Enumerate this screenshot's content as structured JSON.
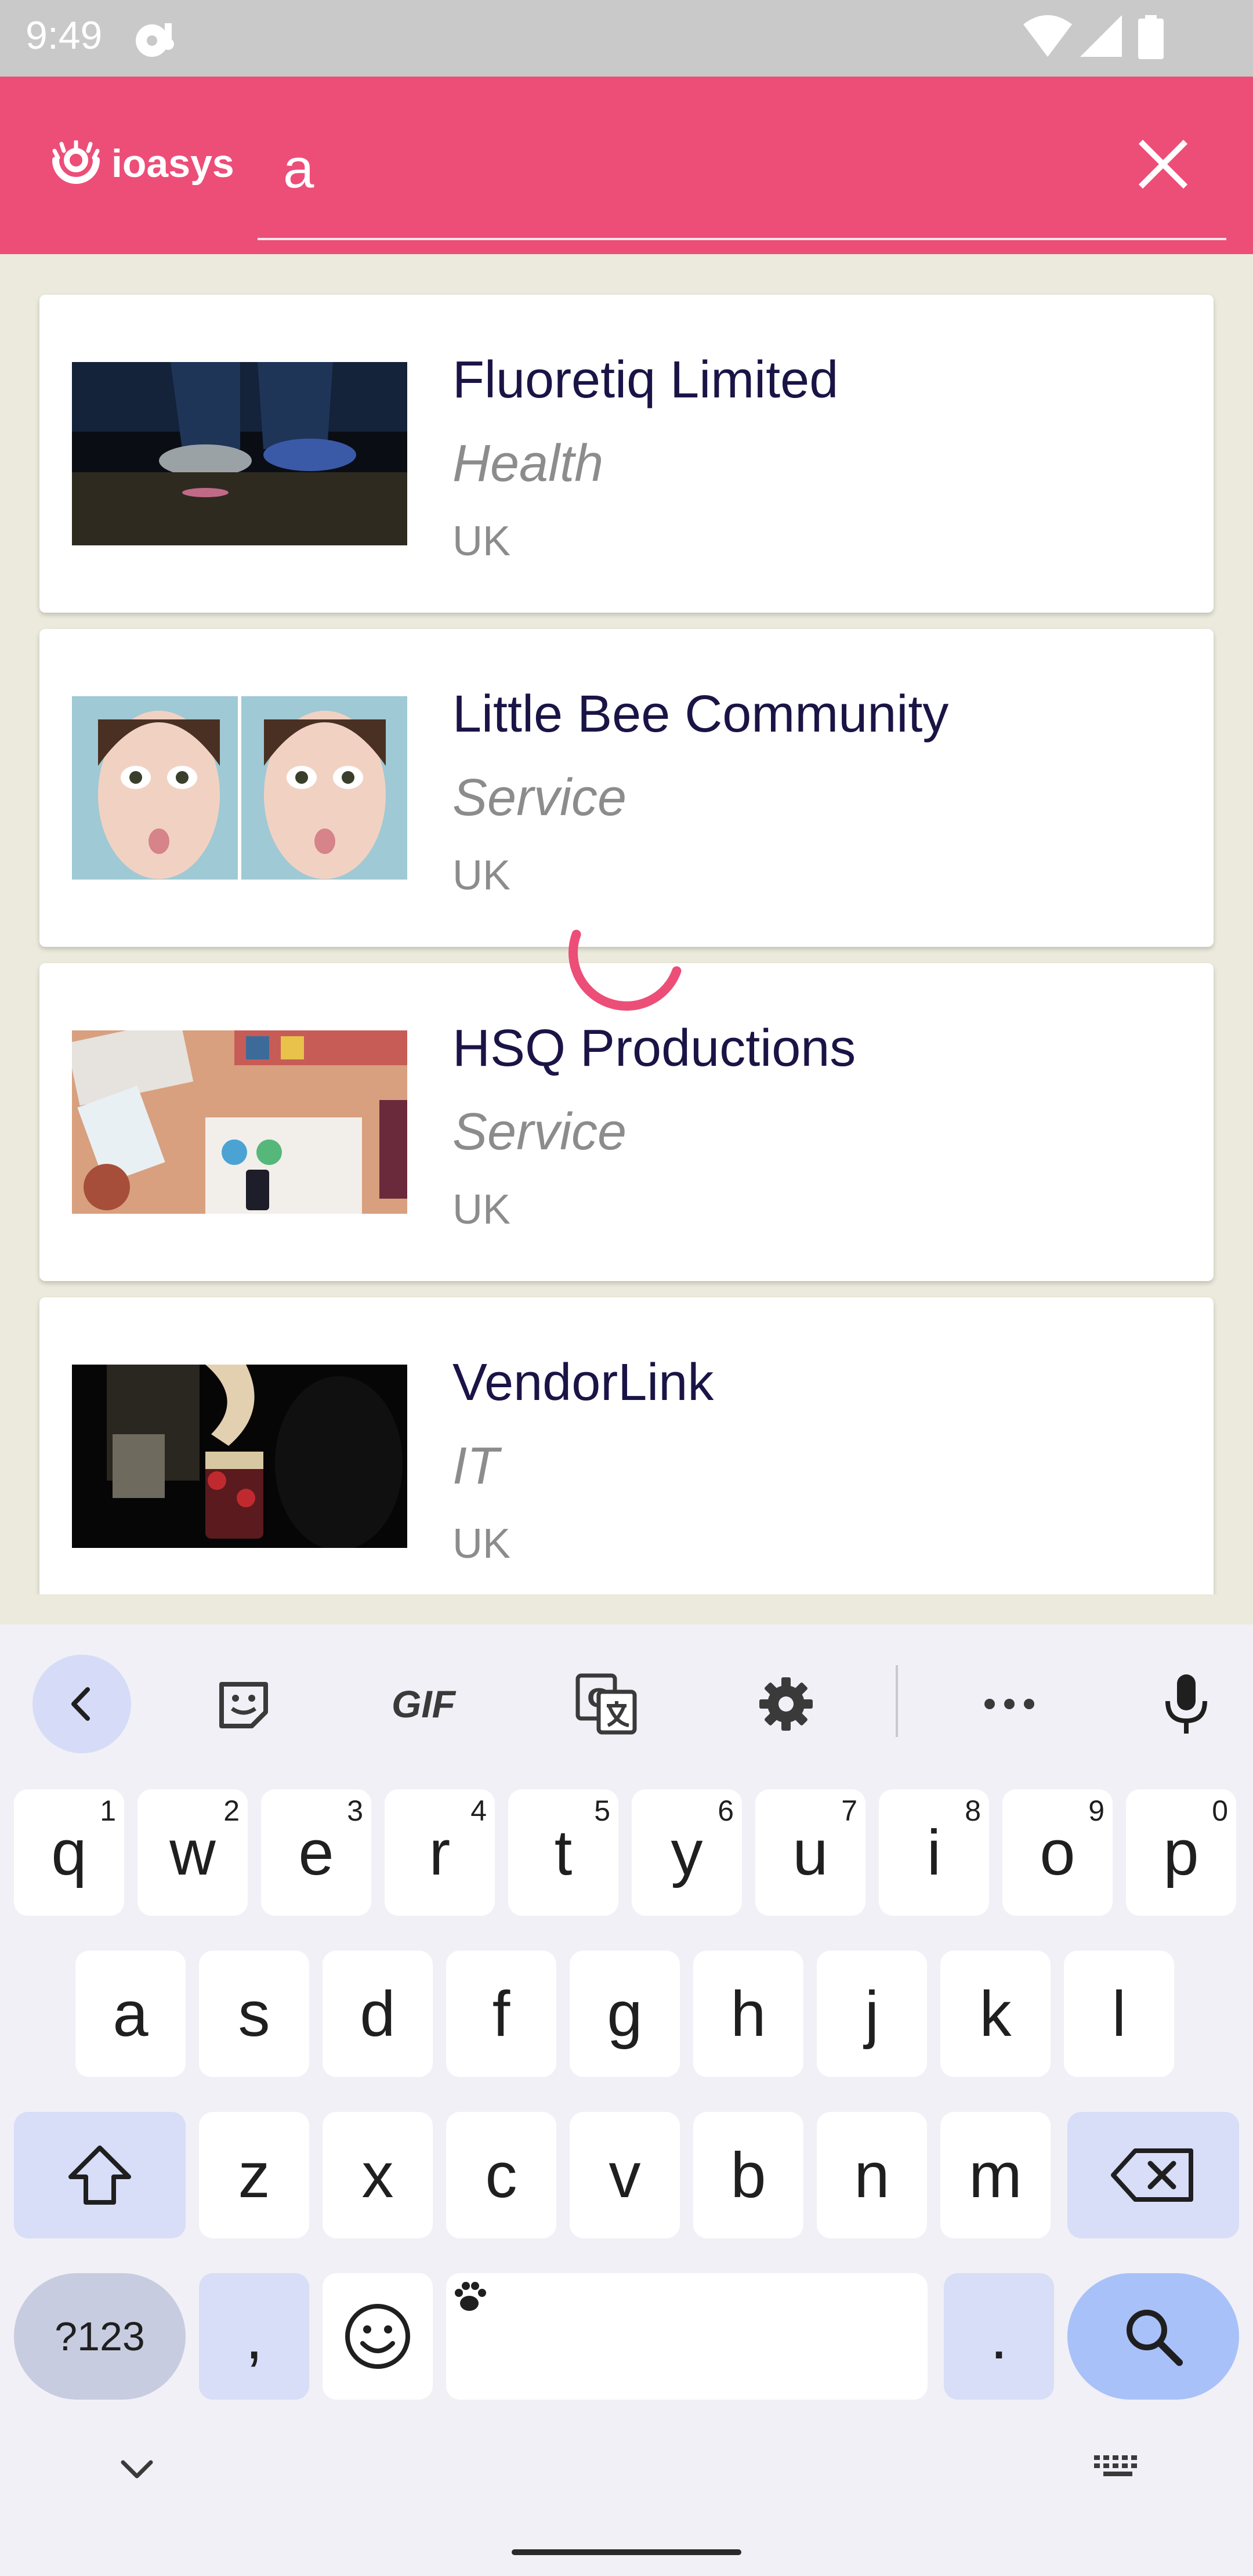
{
  "status_bar": {
    "time": "9:49"
  },
  "app_bar": {
    "logo_text": "ioasys",
    "search": {
      "value": "a",
      "placeholder": ""
    },
    "accent_color": "#EC4E78"
  },
  "companies": [
    {
      "name": "Fluoretiq Limited",
      "category": "Health",
      "country": "UK",
      "thumb": "sneakers-photo"
    },
    {
      "name": "Little Bee Community",
      "category": "Service",
      "country": "UK",
      "thumb": "faces-photo"
    },
    {
      "name": "HSQ Productions",
      "category": "Service",
      "country": "UK",
      "thumb": "desk-photo"
    },
    {
      "name": "VendorLink",
      "category": "IT",
      "country": "UK",
      "thumb": "jar-photo"
    }
  ],
  "keyboard": {
    "toolbar": [
      "back-icon",
      "sticker-icon",
      "GIF",
      "translate-icon",
      "settings-icon",
      "more-icon",
      "mic-icon"
    ],
    "gif_label": "GIF",
    "row1": [
      {
        "k": "q",
        "h": "1"
      },
      {
        "k": "w",
        "h": "2"
      },
      {
        "k": "e",
        "h": "3"
      },
      {
        "k": "r",
        "h": "4"
      },
      {
        "k": "t",
        "h": "5"
      },
      {
        "k": "y",
        "h": "6"
      },
      {
        "k": "u",
        "h": "7"
      },
      {
        "k": "i",
        "h": "8"
      },
      {
        "k": "o",
        "h": "9"
      },
      {
        "k": "p",
        "h": "0"
      }
    ],
    "row2": [
      "a",
      "s",
      "d",
      "f",
      "g",
      "h",
      "j",
      "k",
      "l"
    ],
    "row3": [
      "z",
      "x",
      "c",
      "v",
      "b",
      "n",
      "m"
    ],
    "symbols_label": "?123",
    "comma": ",",
    "period": "."
  }
}
